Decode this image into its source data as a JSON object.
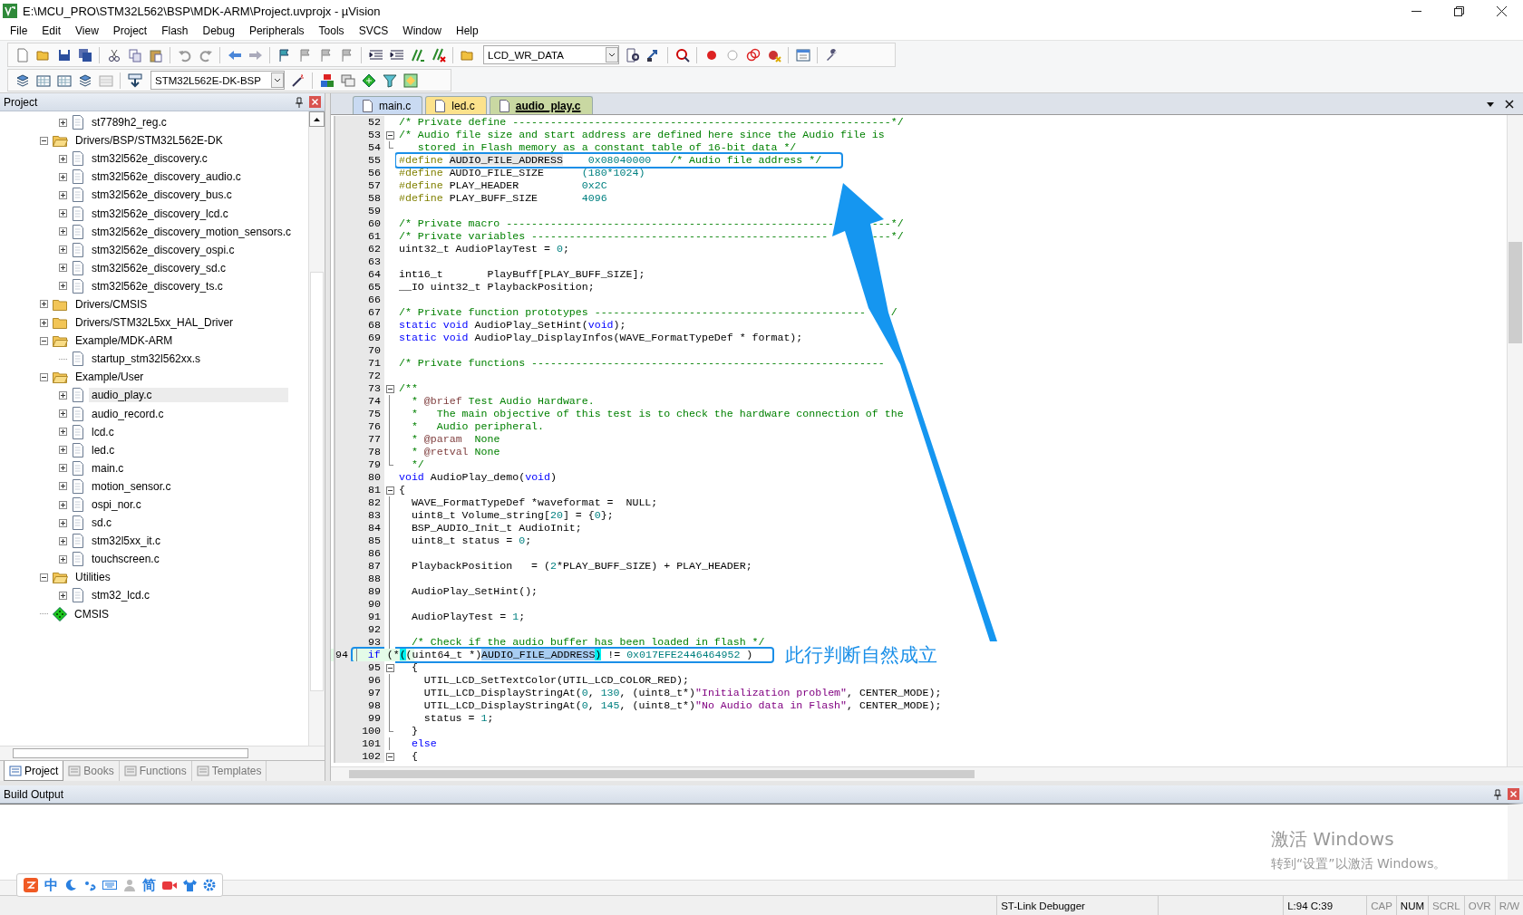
{
  "window": {
    "title": "E:\\MCU_PRO\\STM32L562\\BSP\\MDK-ARM\\Project.uvprojx - µVision"
  },
  "menu": [
    "File",
    "Edit",
    "View",
    "Project",
    "Flash",
    "Debug",
    "Peripherals",
    "Tools",
    "SVCS",
    "Window",
    "Help"
  ],
  "toolbar": {
    "find_combo": "LCD_WR_DATA",
    "target_combo": "STM32L562E-DK-BSP"
  },
  "project_panel": {
    "title": "Project",
    "tree_partial_children": [
      {
        "label": "st7789h2_reg.c",
        "kind": "file",
        "expanded": false,
        "selected": false
      }
    ],
    "tree": [
      {
        "label": "Drivers/BSP/STM32L562E-DK",
        "kind": "folder",
        "expanded": true,
        "selected": false,
        "children": [
          {
            "label": "stm32l562e_discovery.c",
            "kind": "file",
            "expanded": false,
            "selected": false
          },
          {
            "label": "stm32l562e_discovery_audio.c",
            "kind": "file",
            "expanded": false,
            "selected": false
          },
          {
            "label": "stm32l562e_discovery_bus.c",
            "kind": "file",
            "expanded": false,
            "selected": false
          },
          {
            "label": "stm32l562e_discovery_lcd.c",
            "kind": "file",
            "expanded": false,
            "selected": false
          },
          {
            "label": "stm32l562e_discovery_motion_sensors.c",
            "kind": "file",
            "expanded": false,
            "selected": false
          },
          {
            "label": "stm32l562e_discovery_ospi.c",
            "kind": "file",
            "expanded": false,
            "selected": false
          },
          {
            "label": "stm32l562e_discovery_sd.c",
            "kind": "file",
            "expanded": false,
            "selected": false
          },
          {
            "label": "stm32l562e_discovery_ts.c",
            "kind": "file",
            "expanded": false,
            "selected": false
          }
        ]
      },
      {
        "label": "Drivers/CMSIS",
        "kind": "folder",
        "expanded": false,
        "selected": false
      },
      {
        "label": "Drivers/STM32L5xx_HAL_Driver",
        "kind": "folder",
        "expanded": false,
        "selected": false
      },
      {
        "label": "Example/MDK-ARM",
        "kind": "folder",
        "expanded": true,
        "selected": false,
        "children": [
          {
            "label": "startup_stm32l562xx.s",
            "kind": "file",
            "selected": false
          }
        ]
      },
      {
        "label": "Example/User",
        "kind": "folder",
        "expanded": true,
        "selected": false,
        "children": [
          {
            "label": "audio_play.c",
            "kind": "file",
            "expanded": false,
            "selected": true
          },
          {
            "label": "audio_record.c",
            "kind": "file",
            "expanded": false,
            "selected": false
          },
          {
            "label": "lcd.c",
            "kind": "file",
            "expanded": false,
            "selected": false
          },
          {
            "label": "led.c",
            "kind": "file",
            "expanded": false,
            "selected": false
          },
          {
            "label": "main.c",
            "kind": "file",
            "expanded": false,
            "selected": false
          },
          {
            "label": "motion_sensor.c",
            "kind": "file",
            "expanded": false,
            "selected": false
          },
          {
            "label": "ospi_nor.c",
            "kind": "file",
            "expanded": false,
            "selected": false
          },
          {
            "label": "sd.c",
            "kind": "file",
            "expanded": false,
            "selected": false
          },
          {
            "label": "stm32l5xx_it.c",
            "kind": "file",
            "expanded": false,
            "selected": false
          },
          {
            "label": "touchscreen.c",
            "kind": "file",
            "expanded": false,
            "selected": false
          }
        ]
      },
      {
        "label": "Utilities",
        "kind": "folder",
        "expanded": true,
        "selected": false,
        "children": [
          {
            "label": "stm32_lcd.c",
            "kind": "file",
            "expanded": false,
            "selected": false
          }
        ]
      },
      {
        "label": "CMSIS",
        "kind": "component",
        "selected": false
      }
    ],
    "tabs": [
      {
        "label": "Project",
        "selected": true
      },
      {
        "label": "Books",
        "selected": false
      },
      {
        "label": "Functions",
        "selected": false
      },
      {
        "label": "Templates",
        "selected": false
      }
    ]
  },
  "editor": {
    "tabs": [
      {
        "label": "main.c",
        "selected": false,
        "color": "#c9daf2"
      },
      {
        "label": "led.c",
        "selected": false,
        "color": "#fce28c"
      },
      {
        "label": "audio_play.c",
        "selected": true,
        "color": "#c9d8a2"
      }
    ],
    "lines": [
      {
        "number": "52",
        "spans": [
          {
            "kind": "comment",
            "text": "/* Private define ------------------------------------------------------------*/"
          }
        ]
      },
      {
        "number": "53",
        "collapsible": true,
        "spans": [
          {
            "kind": "comment",
            "text": "/* Audio file size and start address are defined here since the Audio file is"
          }
        ]
      },
      {
        "number": "54",
        "fold_end": true,
        "spans": [
          {
            "kind": "comment",
            "text": "   stored in Flash memory as a constant table of 16-bit data */"
          }
        ]
      },
      {
        "number": "55",
        "boxed": true,
        "spans": [
          {
            "kind": "directive",
            "text": "#define "
          },
          {
            "kind": "match",
            "text": "AUDIO_FILE_ADDRESS"
          },
          {
            "kind": "number",
            "text": "    0x08040000"
          },
          {
            "kind": "comment",
            "text": "   /* Audio file address */"
          }
        ]
      },
      {
        "number": "56",
        "spans": [
          {
            "kind": "directive",
            "text": "#define"
          },
          {
            "kind": "plain",
            "text": " AUDIO_FILE_SIZE      "
          },
          {
            "kind": "number",
            "text": "(180*1024)"
          }
        ]
      },
      {
        "number": "57",
        "spans": [
          {
            "kind": "directive",
            "text": "#define"
          },
          {
            "kind": "plain",
            "text": " PLAY_HEADER          "
          },
          {
            "kind": "number",
            "text": "0x2C"
          }
        ]
      },
      {
        "number": "58",
        "spans": [
          {
            "kind": "directive",
            "text": "#define"
          },
          {
            "kind": "plain",
            "text": " PLAY_BUFF_SIZE       "
          },
          {
            "kind": "number",
            "text": "4096"
          }
        ]
      },
      {
        "number": "59"
      },
      {
        "number": "60",
        "spans": [
          {
            "kind": "comment",
            "text": "/* Private macro ----------------------------------------------------"
          },
          {
            "kind": "comment",
            "text": "      ---*/"
          }
        ]
      },
      {
        "number": "61",
        "spans": [
          {
            "kind": "comment",
            "text": "/* Private variables -----------------------------------------------"
          },
          {
            "kind": "comment",
            "text": "       ---*/"
          }
        ]
      },
      {
        "number": "62",
        "spans": [
          {
            "kind": "plain",
            "text": "uint32_t AudioPlayTest = "
          },
          {
            "kind": "number",
            "text": "0"
          },
          {
            "kind": "plain",
            "text": ";"
          }
        ]
      },
      {
        "number": "63"
      },
      {
        "number": "64",
        "spans": [
          {
            "kind": "plain",
            "text": "int16_t       PlayBuff[PLAY_BUFF_SIZE];"
          }
        ]
      },
      {
        "number": "65",
        "spans": [
          {
            "kind": "plain",
            "text": "__IO uint32_t PlaybackPosition;"
          }
        ]
      },
      {
        "number": "66"
      },
      {
        "number": "67",
        "spans": [
          {
            "kind": "comment",
            "text": "/* Private function prototypes -------------------------------------------"
          },
          {
            "kind": "comment",
            "text": "    /"
          }
        ]
      },
      {
        "number": "68",
        "spans": [
          {
            "kind": "keyword",
            "text": "static void"
          },
          {
            "kind": "plain",
            "text": " AudioPlay_SetHint("
          },
          {
            "kind": "keyword",
            "text": "void"
          },
          {
            "kind": "plain",
            "text": ");"
          }
        ]
      },
      {
        "number": "69",
        "spans": [
          {
            "kind": "keyword",
            "text": "static void"
          },
          {
            "kind": "plain",
            "text": " AudioPlay_DisplayInfos(WAVE_FormatTypeDef * format);"
          }
        ]
      },
      {
        "number": "70"
      },
      {
        "number": "71",
        "spans": [
          {
            "kind": "comment",
            "text": "/* Private functions --------------------------------------------------------"
          }
        ]
      },
      {
        "number": "72"
      },
      {
        "number": "73",
        "collapsible": true,
        "spans": [
          {
            "kind": "comment",
            "text": "/**"
          }
        ]
      },
      {
        "number": "74",
        "fold_guide": true,
        "spans": [
          {
            "kind": "comment",
            "text": "  * "
          },
          {
            "kind": "doc",
            "text": "@brief"
          },
          {
            "kind": "comment",
            "text": " Test Audio Hardware."
          }
        ]
      },
      {
        "number": "75",
        "fold_guide": true,
        "spans": [
          {
            "kind": "comment",
            "text": "  *   The main objective of this test is to check the hardware connection of the"
          }
        ]
      },
      {
        "number": "76",
        "fold_guide": true,
        "spans": [
          {
            "kind": "comment",
            "text": "  *   Audio peripheral."
          }
        ]
      },
      {
        "number": "77",
        "fold_guide": true,
        "spans": [
          {
            "kind": "comment",
            "text": "  * "
          },
          {
            "kind": "doc",
            "text": "@param"
          },
          {
            "kind": "comment",
            "text": "  None"
          }
        ]
      },
      {
        "number": "78",
        "fold_guide": true,
        "spans": [
          {
            "kind": "comment",
            "text": "  * "
          },
          {
            "kind": "doc",
            "text": "@retval"
          },
          {
            "kind": "comment",
            "text": " None"
          }
        ]
      },
      {
        "number": "79",
        "fold_end": true,
        "spans": [
          {
            "kind": "comment",
            "text": "  */"
          }
        ]
      },
      {
        "number": "80",
        "spans": [
          {
            "kind": "keyword",
            "text": "void"
          },
          {
            "kind": "plain",
            "text": " AudioPlay_demo("
          },
          {
            "kind": "keyword",
            "text": "void"
          },
          {
            "kind": "plain",
            "text": ")"
          }
        ]
      },
      {
        "number": "81",
        "collapsible": true,
        "spans": [
          {
            "kind": "plain",
            "text": "{"
          }
        ]
      },
      {
        "number": "82",
        "fold_guide": true,
        "spans": [
          {
            "kind": "plain",
            "text": "  WAVE_FormatTypeDef *waveformat =  NULL;"
          }
        ]
      },
      {
        "number": "83",
        "fold_guide": true,
        "spans": [
          {
            "kind": "plain",
            "text": "  uint8_t Volume_string["
          },
          {
            "kind": "number",
            "text": "20"
          },
          {
            "kind": "plain",
            "text": "] = {"
          },
          {
            "kind": "number",
            "text": "0"
          },
          {
            "kind": "plain",
            "text": "};"
          }
        ]
      },
      {
        "number": "84",
        "fold_guide": true,
        "spans": [
          {
            "kind": "plain",
            "text": "  BSP_AUDIO_Init_t AudioInit;"
          }
        ]
      },
      {
        "number": "85",
        "fold_guide": true,
        "spans": [
          {
            "kind": "plain",
            "text": "  uint8_t status = "
          },
          {
            "kind": "number",
            "text": "0"
          },
          {
            "kind": "plain",
            "text": ";"
          }
        ]
      },
      {
        "number": "86",
        "fold_guide": true
      },
      {
        "number": "87",
        "fold_guide": true,
        "spans": [
          {
            "kind": "plain",
            "text": "  PlaybackPosition   = ("
          },
          {
            "kind": "number",
            "text": "2"
          },
          {
            "kind": "plain",
            "text": "*PLAY_BUFF_SIZE) + PLAY_HEADER;"
          }
        ]
      },
      {
        "number": "88",
        "fold_guide": true
      },
      {
        "number": "89",
        "fold_guide": true,
        "spans": [
          {
            "kind": "plain",
            "text": "  AudioPlay_SetHint();"
          }
        ]
      },
      {
        "number": "90",
        "fold_guide": true
      },
      {
        "number": "91",
        "fold_guide": true,
        "spans": [
          {
            "kind": "plain",
            "text": "  AudioPlayTest = "
          },
          {
            "kind": "number",
            "text": "1"
          },
          {
            "kind": "plain",
            "text": ";"
          }
        ]
      },
      {
        "number": "92",
        "fold_guide": true
      },
      {
        "number": "93",
        "fold_guide": true,
        "spans": [
          {
            "kind": "comment",
            "text": "  /* Check if the audio buffer has been loaded in flash */"
          }
        ]
      },
      {
        "number": "94",
        "fold_guide": true,
        "current": true,
        "boxed": true,
        "callout": "此行判断自然成立",
        "spans": [
          {
            "kind": "keyword",
            "text": "  if"
          },
          {
            "kind": "plain",
            "text": " (*"
          },
          {
            "kind": "brace",
            "text": "("
          },
          {
            "kind": "plain",
            "text": "(uint64_t *)"
          },
          {
            "kind": "selected",
            "text": "AUDIO_FILE_ADDRESS"
          },
          {
            "kind": "brace",
            "text": ")"
          },
          {
            "kind": "plain",
            "text": " != "
          },
          {
            "kind": "number",
            "text": "0x017EFE2446464952"
          },
          {
            "kind": "plain",
            "text": " )"
          }
        ]
      },
      {
        "number": "95",
        "collapsible": true,
        "spans": [
          {
            "kind": "plain",
            "text": "  {"
          }
        ]
      },
      {
        "number": "96",
        "fold_guide": true,
        "spans": [
          {
            "kind": "plain",
            "text": "    UTIL_LCD_SetTextColor(UTIL_LCD_COLOR_RED);"
          }
        ]
      },
      {
        "number": "97",
        "fold_guide": true,
        "spans": [
          {
            "kind": "plain",
            "text": "    UTIL_LCD_DisplayStringAt("
          },
          {
            "kind": "number",
            "text": "0"
          },
          {
            "kind": "plain",
            "text": ", "
          },
          {
            "kind": "number",
            "text": "130"
          },
          {
            "kind": "plain",
            "text": ", (uint8_t*)"
          },
          {
            "kind": "string",
            "text": "\"Initialization problem\""
          },
          {
            "kind": "plain",
            "text": ", CENTER_MODE);"
          }
        ]
      },
      {
        "number": "98",
        "fold_guide": true,
        "spans": [
          {
            "kind": "plain",
            "text": "    UTIL_LCD_DisplayStringAt("
          },
          {
            "kind": "number",
            "text": "0"
          },
          {
            "kind": "plain",
            "text": ", "
          },
          {
            "kind": "number",
            "text": "145"
          },
          {
            "kind": "plain",
            "text": ", (uint8_t*)"
          },
          {
            "kind": "string",
            "text": "\"No Audio data in Flash\""
          },
          {
            "kind": "plain",
            "text": ", CENTER_MODE);"
          }
        ]
      },
      {
        "number": "99",
        "fold_guide": true,
        "spans": [
          {
            "kind": "plain",
            "text": "    status = "
          },
          {
            "kind": "number",
            "text": "1"
          },
          {
            "kind": "plain",
            "text": ";"
          }
        ]
      },
      {
        "number": "100",
        "fold_end": true,
        "spans": [
          {
            "kind": "plain",
            "text": "  }"
          }
        ]
      },
      {
        "number": "101",
        "fold_guide": true,
        "spans": [
          {
            "kind": "keyword",
            "text": "  else"
          }
        ]
      },
      {
        "number": "102",
        "collapsible": true,
        "spans": [
          {
            "kind": "plain",
            "text": "  {"
          }
        ]
      }
    ]
  },
  "build_output": {
    "title": "Build Output"
  },
  "ime_bar": {
    "language": "中",
    "script": "简"
  },
  "activation_notice": {
    "title": "激活 Windows",
    "message": "转到“设置”以激活 Windows。"
  },
  "status_bar": {
    "debugger": "ST-Link Debugger",
    "cursor": "L:94 C:39",
    "indicators": [
      {
        "text": "CAP",
        "on": false
      },
      {
        "text": "NUM",
        "on": true
      },
      {
        "text": "SCRL",
        "on": false
      },
      {
        "text": "OVR",
        "on": false
      },
      {
        "text": "R/W",
        "on": false
      }
    ]
  }
}
